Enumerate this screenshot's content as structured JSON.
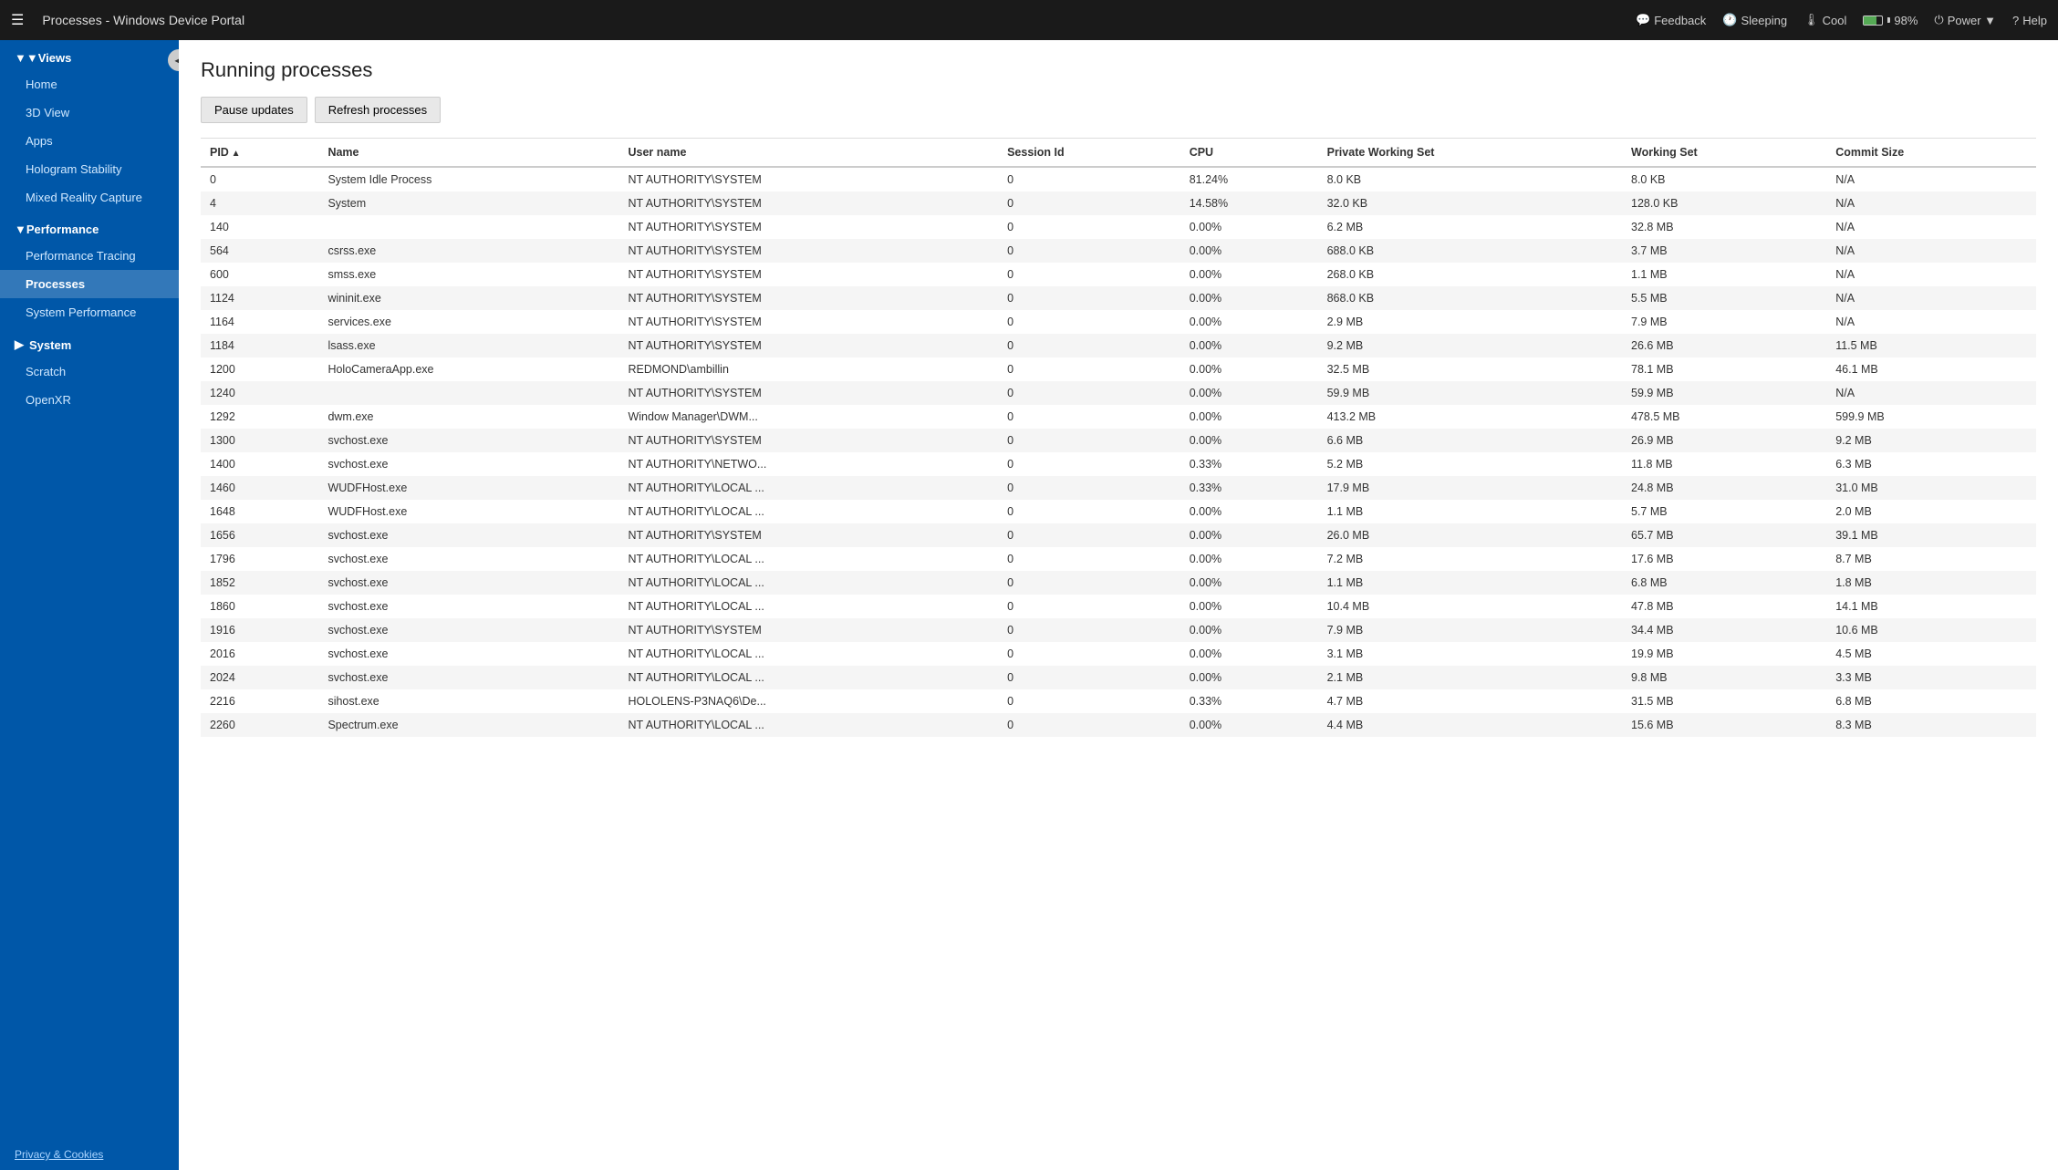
{
  "topbar": {
    "hamburger": "☰",
    "title": "Processes - Windows Device Portal",
    "feedback_label": "Feedback",
    "sleeping_label": "Sleeping",
    "cool_label": "Cool",
    "battery_percent": "98%",
    "power_label": "Power ▼",
    "help_label": "Help"
  },
  "sidebar": {
    "collapse_icon": "◀",
    "views_label": "▼Views",
    "items_views": [
      {
        "label": "Home",
        "active": false
      },
      {
        "label": "3D View",
        "active": false
      },
      {
        "label": "Apps",
        "active": false
      },
      {
        "label": "Hologram Stability",
        "active": false
      },
      {
        "label": "Mixed Reality Capture",
        "active": false
      }
    ],
    "performance_label": "▼Performance",
    "items_performance": [
      {
        "label": "Performance Tracing",
        "active": false
      },
      {
        "label": "Processes",
        "active": true
      },
      {
        "label": "System Performance",
        "active": false
      }
    ],
    "system_label": "▶System",
    "scratch_label": "Scratch",
    "openxr_label": "OpenXR",
    "footer_label": "Privacy & Cookies"
  },
  "content": {
    "title": "Running processes",
    "toolbar": {
      "pause_label": "Pause updates",
      "refresh_label": "Refresh processes"
    },
    "table": {
      "columns": [
        "PID",
        "Name",
        "User name",
        "Session Id",
        "CPU",
        "Private Working Set",
        "Working Set",
        "Commit Size"
      ],
      "sorted_col": "PID",
      "rows": [
        {
          "pid": "0",
          "name": "System Idle Process",
          "user": "NT AUTHORITY\\SYSTEM",
          "session": "0",
          "cpu": "81.24%",
          "private_ws": "8.0 KB",
          "ws": "8.0 KB",
          "commit": "N/A"
        },
        {
          "pid": "4",
          "name": "System",
          "user": "NT AUTHORITY\\SYSTEM",
          "session": "0",
          "cpu": "14.58%",
          "private_ws": "32.0 KB",
          "ws": "128.0 KB",
          "commit": "N/A"
        },
        {
          "pid": "140",
          "name": "",
          "user": "NT AUTHORITY\\SYSTEM",
          "session": "0",
          "cpu": "0.00%",
          "private_ws": "6.2 MB",
          "ws": "32.8 MB",
          "commit": "N/A"
        },
        {
          "pid": "564",
          "name": "csrss.exe",
          "user": "NT AUTHORITY\\SYSTEM",
          "session": "0",
          "cpu": "0.00%",
          "private_ws": "688.0 KB",
          "ws": "3.7 MB",
          "commit": "N/A"
        },
        {
          "pid": "600",
          "name": "smss.exe",
          "user": "NT AUTHORITY\\SYSTEM",
          "session": "0",
          "cpu": "0.00%",
          "private_ws": "268.0 KB",
          "ws": "1.1 MB",
          "commit": "N/A"
        },
        {
          "pid": "1124",
          "name": "wininit.exe",
          "user": "NT AUTHORITY\\SYSTEM",
          "session": "0",
          "cpu": "0.00%",
          "private_ws": "868.0 KB",
          "ws": "5.5 MB",
          "commit": "N/A"
        },
        {
          "pid": "1164",
          "name": "services.exe",
          "user": "NT AUTHORITY\\SYSTEM",
          "session": "0",
          "cpu": "0.00%",
          "private_ws": "2.9 MB",
          "ws": "7.9 MB",
          "commit": "N/A"
        },
        {
          "pid": "1184",
          "name": "lsass.exe",
          "user": "NT AUTHORITY\\SYSTEM",
          "session": "0",
          "cpu": "0.00%",
          "private_ws": "9.2 MB",
          "ws": "26.6 MB",
          "commit": "11.5 MB"
        },
        {
          "pid": "1200",
          "name": "HoloCameraApp.exe",
          "user": "REDMOND\\ambillin",
          "session": "0",
          "cpu": "0.00%",
          "private_ws": "32.5 MB",
          "ws": "78.1 MB",
          "commit": "46.1 MB"
        },
        {
          "pid": "1240",
          "name": "",
          "user": "NT AUTHORITY\\SYSTEM",
          "session": "0",
          "cpu": "0.00%",
          "private_ws": "59.9 MB",
          "ws": "59.9 MB",
          "commit": "N/A"
        },
        {
          "pid": "1292",
          "name": "dwm.exe",
          "user": "Window Manager\\DWM...",
          "session": "0",
          "cpu": "0.00%",
          "private_ws": "413.2 MB",
          "ws": "478.5 MB",
          "commit": "599.9 MB"
        },
        {
          "pid": "1300",
          "name": "svchost.exe",
          "user": "NT AUTHORITY\\SYSTEM",
          "session": "0",
          "cpu": "0.00%",
          "private_ws": "6.6 MB",
          "ws": "26.9 MB",
          "commit": "9.2 MB"
        },
        {
          "pid": "1400",
          "name": "svchost.exe",
          "user": "NT AUTHORITY\\NETWO...",
          "session": "0",
          "cpu": "0.33%",
          "private_ws": "5.2 MB",
          "ws": "11.8 MB",
          "commit": "6.3 MB"
        },
        {
          "pid": "1460",
          "name": "WUDFHost.exe",
          "user": "NT AUTHORITY\\LOCAL ...",
          "session": "0",
          "cpu": "0.33%",
          "private_ws": "17.9 MB",
          "ws": "24.8 MB",
          "commit": "31.0 MB"
        },
        {
          "pid": "1648",
          "name": "WUDFHost.exe",
          "user": "NT AUTHORITY\\LOCAL ...",
          "session": "0",
          "cpu": "0.00%",
          "private_ws": "1.1 MB",
          "ws": "5.7 MB",
          "commit": "2.0 MB"
        },
        {
          "pid": "1656",
          "name": "svchost.exe",
          "user": "NT AUTHORITY\\SYSTEM",
          "session": "0",
          "cpu": "0.00%",
          "private_ws": "26.0 MB",
          "ws": "65.7 MB",
          "commit": "39.1 MB"
        },
        {
          "pid": "1796",
          "name": "svchost.exe",
          "user": "NT AUTHORITY\\LOCAL ...",
          "session": "0",
          "cpu": "0.00%",
          "private_ws": "7.2 MB",
          "ws": "17.6 MB",
          "commit": "8.7 MB"
        },
        {
          "pid": "1852",
          "name": "svchost.exe",
          "user": "NT AUTHORITY\\LOCAL ...",
          "session": "0",
          "cpu": "0.00%",
          "private_ws": "1.1 MB",
          "ws": "6.8 MB",
          "commit": "1.8 MB"
        },
        {
          "pid": "1860",
          "name": "svchost.exe",
          "user": "NT AUTHORITY\\LOCAL ...",
          "session": "0",
          "cpu": "0.00%",
          "private_ws": "10.4 MB",
          "ws": "47.8 MB",
          "commit": "14.1 MB"
        },
        {
          "pid": "1916",
          "name": "svchost.exe",
          "user": "NT AUTHORITY\\SYSTEM",
          "session": "0",
          "cpu": "0.00%",
          "private_ws": "7.9 MB",
          "ws": "34.4 MB",
          "commit": "10.6 MB"
        },
        {
          "pid": "2016",
          "name": "svchost.exe",
          "user": "NT AUTHORITY\\LOCAL ...",
          "session": "0",
          "cpu": "0.00%",
          "private_ws": "3.1 MB",
          "ws": "19.9 MB",
          "commit": "4.5 MB"
        },
        {
          "pid": "2024",
          "name": "svchost.exe",
          "user": "NT AUTHORITY\\LOCAL ...",
          "session": "0",
          "cpu": "0.00%",
          "private_ws": "2.1 MB",
          "ws": "9.8 MB",
          "commit": "3.3 MB"
        },
        {
          "pid": "2216",
          "name": "sihost.exe",
          "user": "HOLOLENS-P3NAQ6\\De...",
          "session": "0",
          "cpu": "0.33%",
          "private_ws": "4.7 MB",
          "ws": "31.5 MB",
          "commit": "6.8 MB"
        },
        {
          "pid": "2260",
          "name": "Spectrum.exe",
          "user": "NT AUTHORITY\\LOCAL ...",
          "session": "0",
          "cpu": "0.00%",
          "private_ws": "4.4 MB",
          "ws": "15.6 MB",
          "commit": "8.3 MB"
        }
      ]
    }
  }
}
